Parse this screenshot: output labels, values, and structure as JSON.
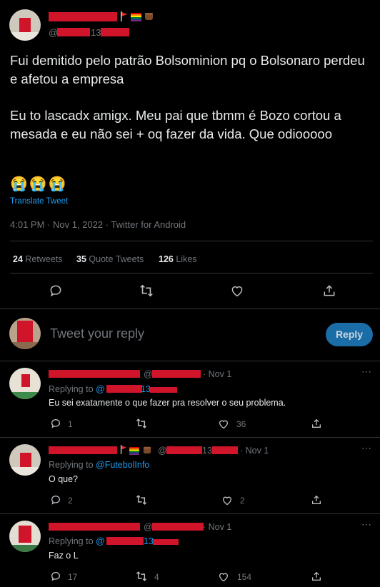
{
  "main_tweet": {
    "handle_suffix": "13",
    "text_p1": "Fui demitido pelo patrão Bolsominion pq o Bolsonaro perdeu e afetou a empresa",
    "text_p2": "Eu to lascadx amigx. Meu pai que tbmm é Bozo cortou a mesada e eu não sei + oq fazer da vida. Que odiooooo",
    "emojis": "😭😭😭",
    "translate": "Translate Tweet",
    "meta": "4:01 PM · Nov 1, 2022 · Twitter for Android",
    "stats": {
      "retweets_count": "24",
      "retweets_label": "Retweets",
      "quotes_count": "35",
      "quotes_label": "Quote Tweets",
      "likes_count": "126",
      "likes_label": "Likes"
    }
  },
  "reply_box": {
    "placeholder": "Tweet your reply",
    "button": "Reply"
  },
  "replies": [
    {
      "handle_prefix": "@",
      "handle_suffix": "",
      "time": "· Nov 1",
      "replying_label": "Replying to",
      "replying_to_prefix": "@",
      "replying_to_suffix": "13",
      "text": "Eu sei exatamente o que fazer pra resolver o seu problema.",
      "reply_count": "1",
      "retweet_count": "",
      "like_count": "36"
    },
    {
      "handle_prefix": "@",
      "handle_suffix": "13",
      "time": "· Nov 1",
      "replying_label": "Replying to",
      "replying_to_prefix": "@FutebolInfo",
      "replying_to_suffix": "",
      "text": "O que?",
      "reply_count": "2",
      "retweet_count": "",
      "like_count": "2"
    },
    {
      "handle_prefix": "@",
      "handle_suffix": "",
      "time": "· Nov 1",
      "replying_label": "Replying to",
      "replying_to_prefix": "@",
      "replying_to_suffix": "13",
      "text": "Faz o L",
      "reply_count": "17",
      "retweet_count": "4",
      "like_count": "154"
    }
  ],
  "colors": {
    "accent": "#1d9bf0",
    "background": "#000000",
    "muted": "#71767b",
    "redaction": "#d0142a"
  }
}
